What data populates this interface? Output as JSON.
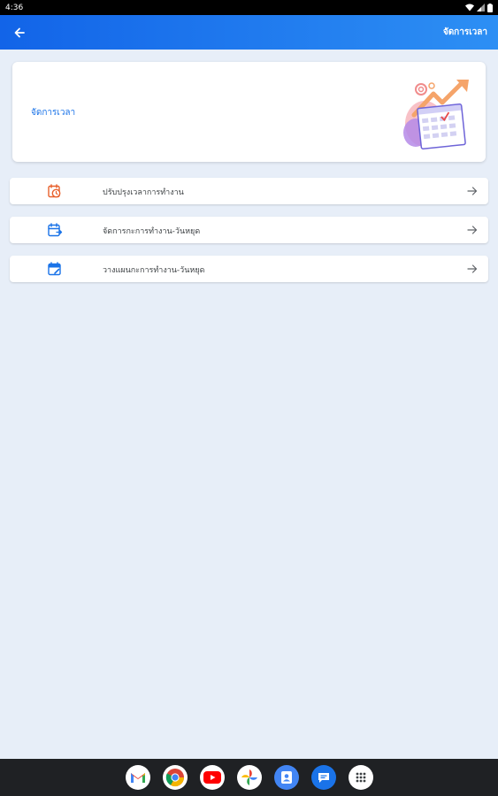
{
  "status_bar": {
    "time": "4:36"
  },
  "app_bar": {
    "title": "จัดการเวลา"
  },
  "hero": {
    "title": "จัดการเวลา"
  },
  "menu": [
    {
      "label": "ปรับปรุงเวลาการทำงาน",
      "icon": "clock-calendar-icon",
      "icon_color": "#e8602c"
    },
    {
      "label": "จัดการกะการทำงาน-วันหยุด",
      "icon": "calendar-swap-icon",
      "icon_color": "#1a73e8"
    },
    {
      "label": "วางแผนกะการทำงาน-วันหยุด",
      "icon": "calendar-edit-icon",
      "icon_color": "#1a73e8"
    }
  ],
  "dock": [
    "gmail-icon",
    "chrome-icon",
    "youtube-icon",
    "photos-icon",
    "contacts-icon",
    "messages-icon",
    "app-drawer-icon"
  ],
  "colors": {
    "primary": "#1a73e8",
    "app_bar_start": "#1264e8",
    "app_bar_end": "#2d8ff4",
    "background": "#e7eef8",
    "accent_orange": "#e8602c"
  }
}
